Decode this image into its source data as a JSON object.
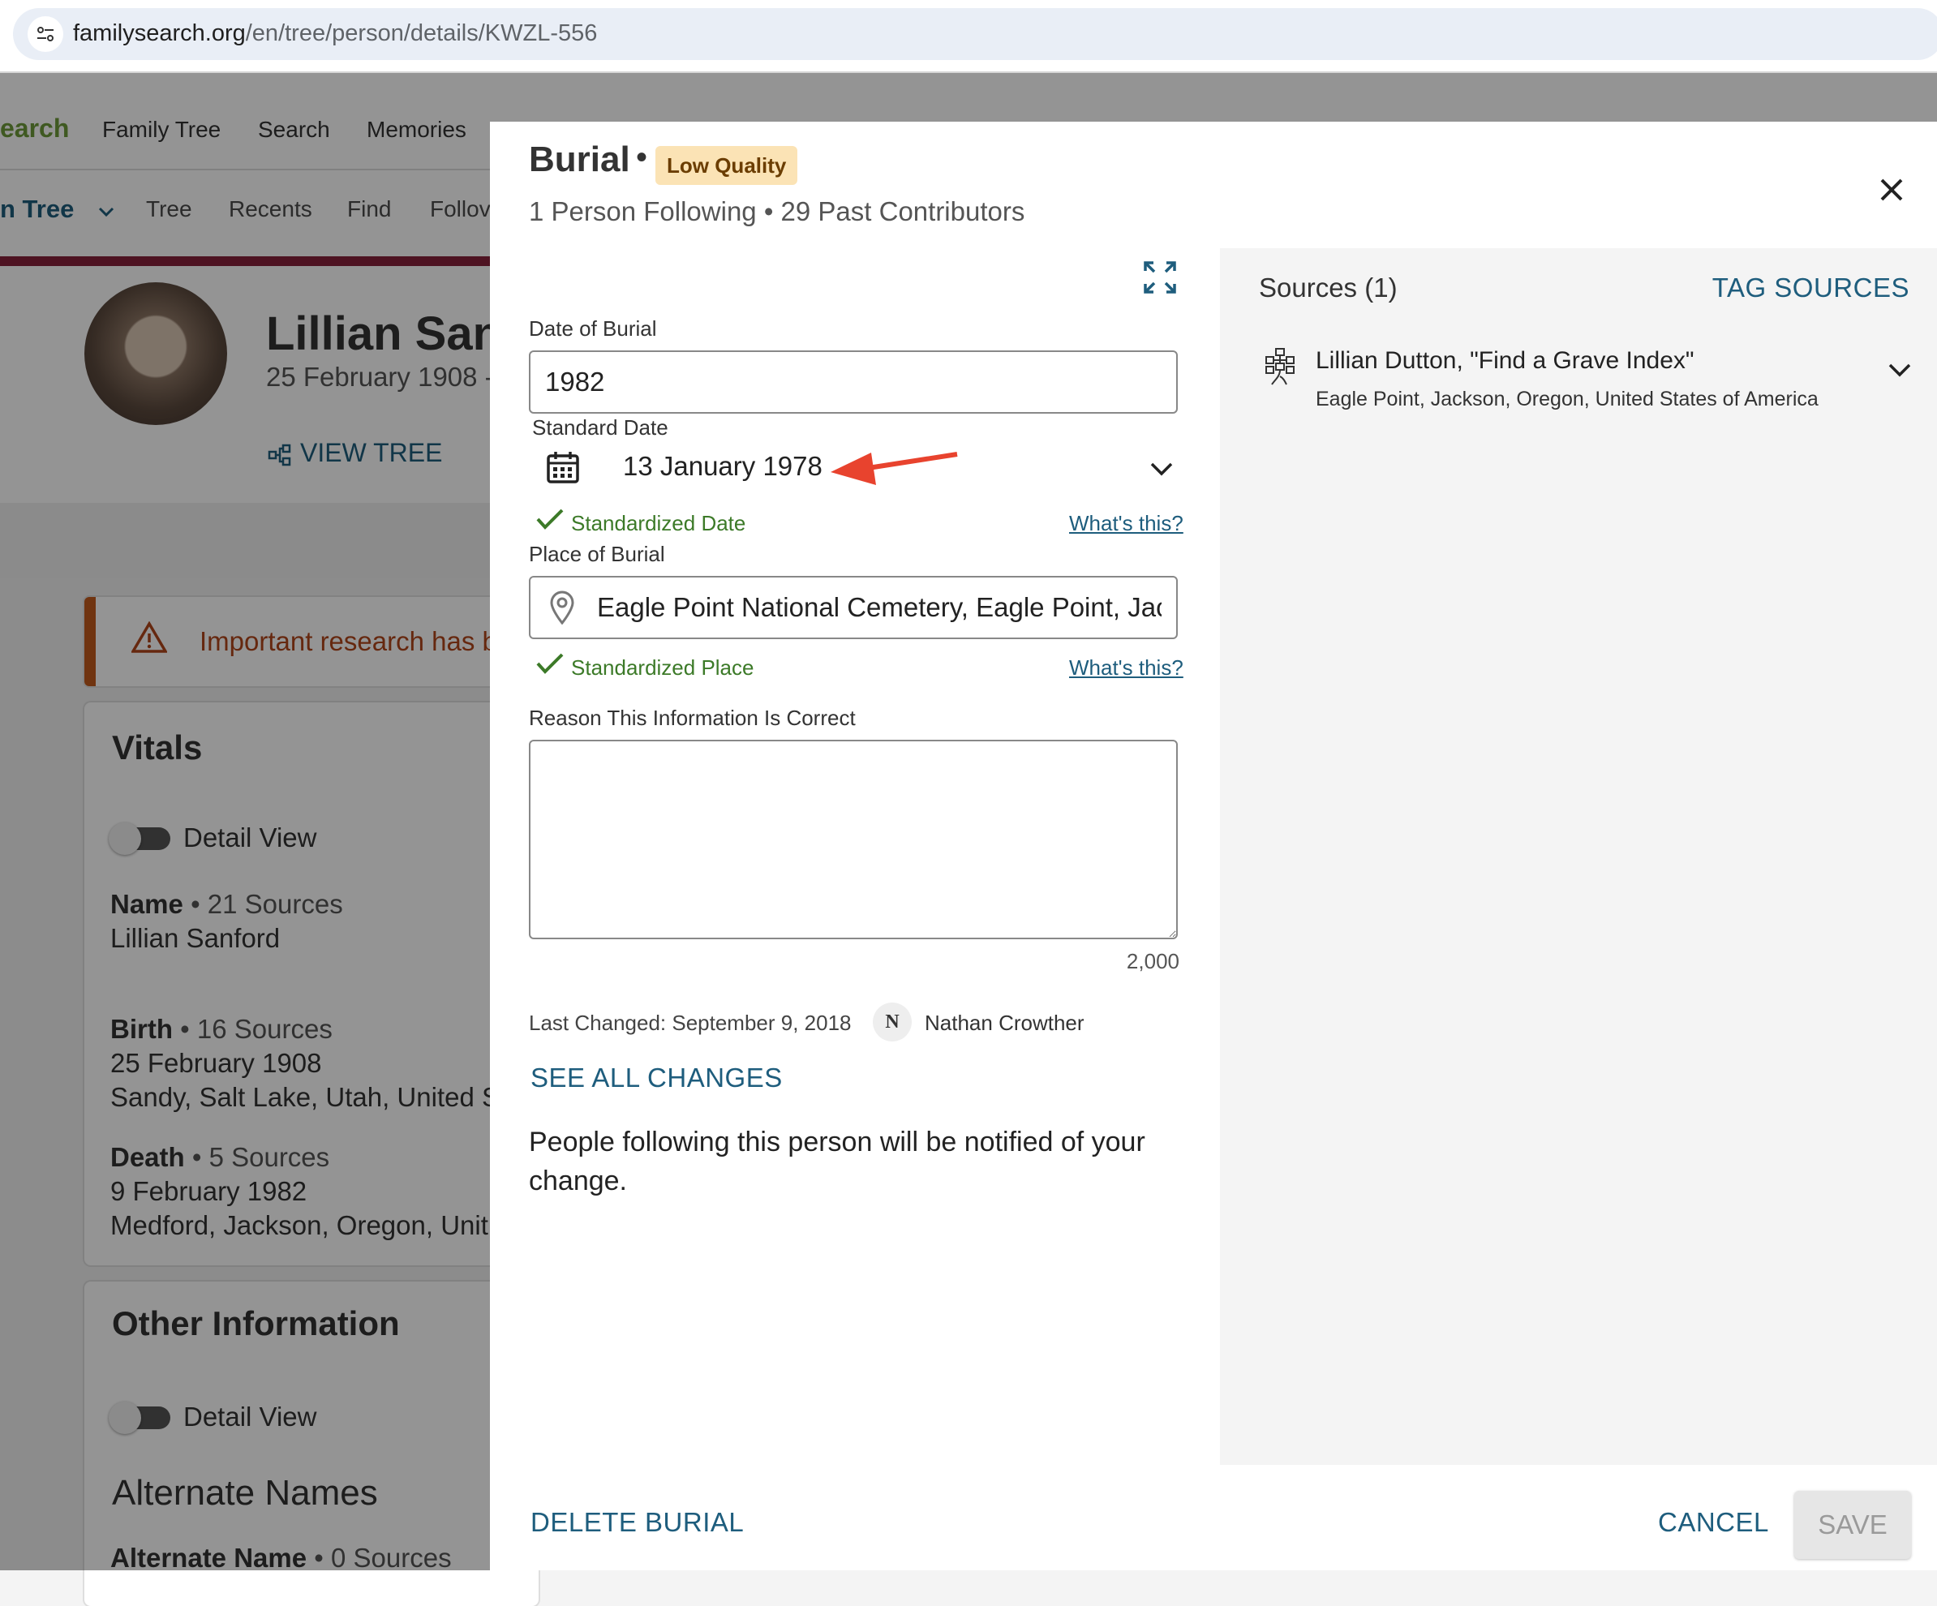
{
  "browser": {
    "url_domain": "familysearch.org",
    "url_path": "/en/tree/person/details/KWZL-556"
  },
  "background": {
    "brand": "earch",
    "nav": [
      "Family Tree",
      "Search",
      "Memories"
    ],
    "tree_menu": "n Tree",
    "subnav": [
      "Tree",
      "Recents",
      "Find",
      "Follov"
    ],
    "person_name": "Lillian Sanf",
    "person_dates": "25 February 1908 -",
    "view_tree": "VIEW TREE",
    "alert": "Important research has b",
    "vitals": {
      "title": "Vitals",
      "detail_view": "Detail View",
      "name_label": "Name",
      "name_sources": "• 21 Sources",
      "name_value": "Lillian Sanford",
      "birth_label": "Birth",
      "birth_sources": "• 16 Sources",
      "birth_date": "25 February 1908",
      "birth_place": "Sandy, Salt Lake, Utah, United S",
      "death_label": "Death",
      "death_sources": "• 5 Sources",
      "death_date": "9 February 1982",
      "death_place": "Medford, Jackson, Oregon, Unit"
    },
    "other": {
      "title": "Other Information",
      "detail_view": "Detail View",
      "alternate_names": "Alternate Names",
      "alt_name_label": "Alternate Name",
      "alt_name_sources": "• 0 Sources"
    }
  },
  "modal": {
    "title": "Burial",
    "dot": "•",
    "quality_badge": "Low Quality",
    "subtitle": "1 Person Following • 29 Past Contributors",
    "date_label": "Date of Burial",
    "date_value": "1982",
    "standard_date_label": "Standard Date",
    "standard_date_value": "13 January 1978",
    "standardized_date": "Standardized Date",
    "whats_this": "What's this?",
    "place_label": "Place of Burial",
    "place_value": "Eagle Point National Cemetery, Eagle Point, Jac",
    "standardized_place": "Standardized Place",
    "reason_label": "Reason This Information Is Correct",
    "reason_value": "",
    "char_count": "2,000",
    "last_changed": "Last Changed: September 9, 2018",
    "contributor_initial": "N",
    "contributor_name": "Nathan Crowther",
    "see_all_changes": "SEE ALL CHANGES",
    "notify_text": "People following this person will be notified of your change.",
    "delete_label": "DELETE BURIAL",
    "cancel_label": "CANCEL",
    "save_label": "SAVE"
  },
  "sources": {
    "title": "Sources (1)",
    "tag_sources": "TAG SOURCES",
    "items": [
      {
        "title": "Lillian Dutton, \"Find a Grave Index\"",
        "place": "Eagle Point, Jackson, Oregon, United States of America"
      }
    ]
  },
  "colors": {
    "link_blue": "#1e5d7d",
    "standardized_green": "#3c7a28",
    "badge_bg": "#fbe3b5",
    "annotation_arrow": "#e8432e",
    "banner_red": "#87213b"
  }
}
